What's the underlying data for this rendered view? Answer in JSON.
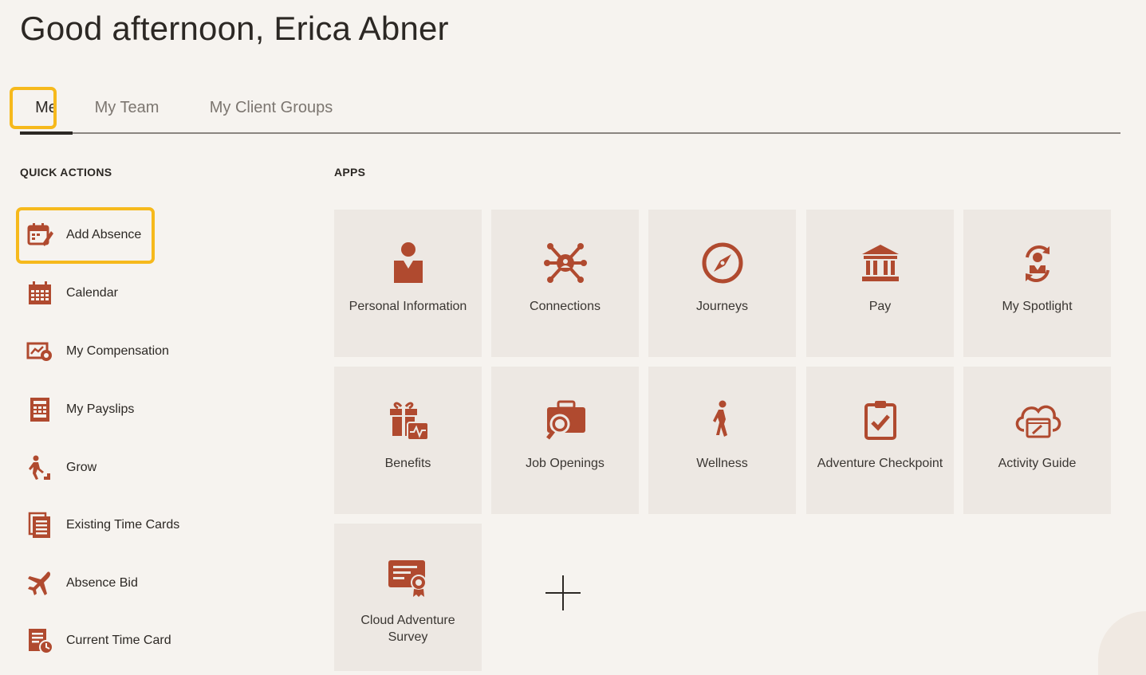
{
  "greeting": "Good afternoon, Erica Abner",
  "tabs": [
    {
      "label": "Me",
      "active": true
    },
    {
      "label": "My Team"
    },
    {
      "label": "My Client Groups"
    }
  ],
  "quick_actions": {
    "title": "QUICK ACTIONS",
    "items": [
      {
        "label": "Add Absence",
        "icon": "add-absence-icon"
      },
      {
        "label": "Calendar",
        "icon": "calendar-icon"
      },
      {
        "label": "My Compensation",
        "icon": "compensation-icon"
      },
      {
        "label": "My Payslips",
        "icon": "payslip-icon"
      },
      {
        "label": "Grow",
        "icon": "grow-icon"
      },
      {
        "label": "Existing Time Cards",
        "icon": "time-cards-icon"
      },
      {
        "label": "Absence Bid",
        "icon": "absence-bid-icon"
      },
      {
        "label": "Current Time Card",
        "icon": "current-time-card-icon"
      }
    ]
  },
  "apps": {
    "title": "APPS",
    "tiles": [
      {
        "label": "Personal Information",
        "icon": "person-icon"
      },
      {
        "label": "Connections",
        "icon": "connections-icon"
      },
      {
        "label": "Journeys",
        "icon": "compass-icon"
      },
      {
        "label": "Pay",
        "icon": "bank-icon"
      },
      {
        "label": "My Spotlight",
        "icon": "spotlight-icon"
      },
      {
        "label": "Benefits",
        "icon": "benefits-gift-icon"
      },
      {
        "label": "Job Openings",
        "icon": "briefcase-search-icon"
      },
      {
        "label": "Wellness",
        "icon": "wellness-figure-icon"
      },
      {
        "label": "Adventure Checkpoint",
        "icon": "clipboard-check-icon"
      },
      {
        "label": "Activity Guide",
        "icon": "cloud-activity-icon"
      },
      {
        "label": "Cloud Adventure Survey",
        "icon": "survey-certificate-icon"
      }
    ],
    "add_tile_icon": "plus-icon"
  },
  "colors": {
    "icon": "#b04a2f",
    "highlight": "#f6b91c",
    "background": "#f6f3ef",
    "tile": "#ede8e3"
  }
}
